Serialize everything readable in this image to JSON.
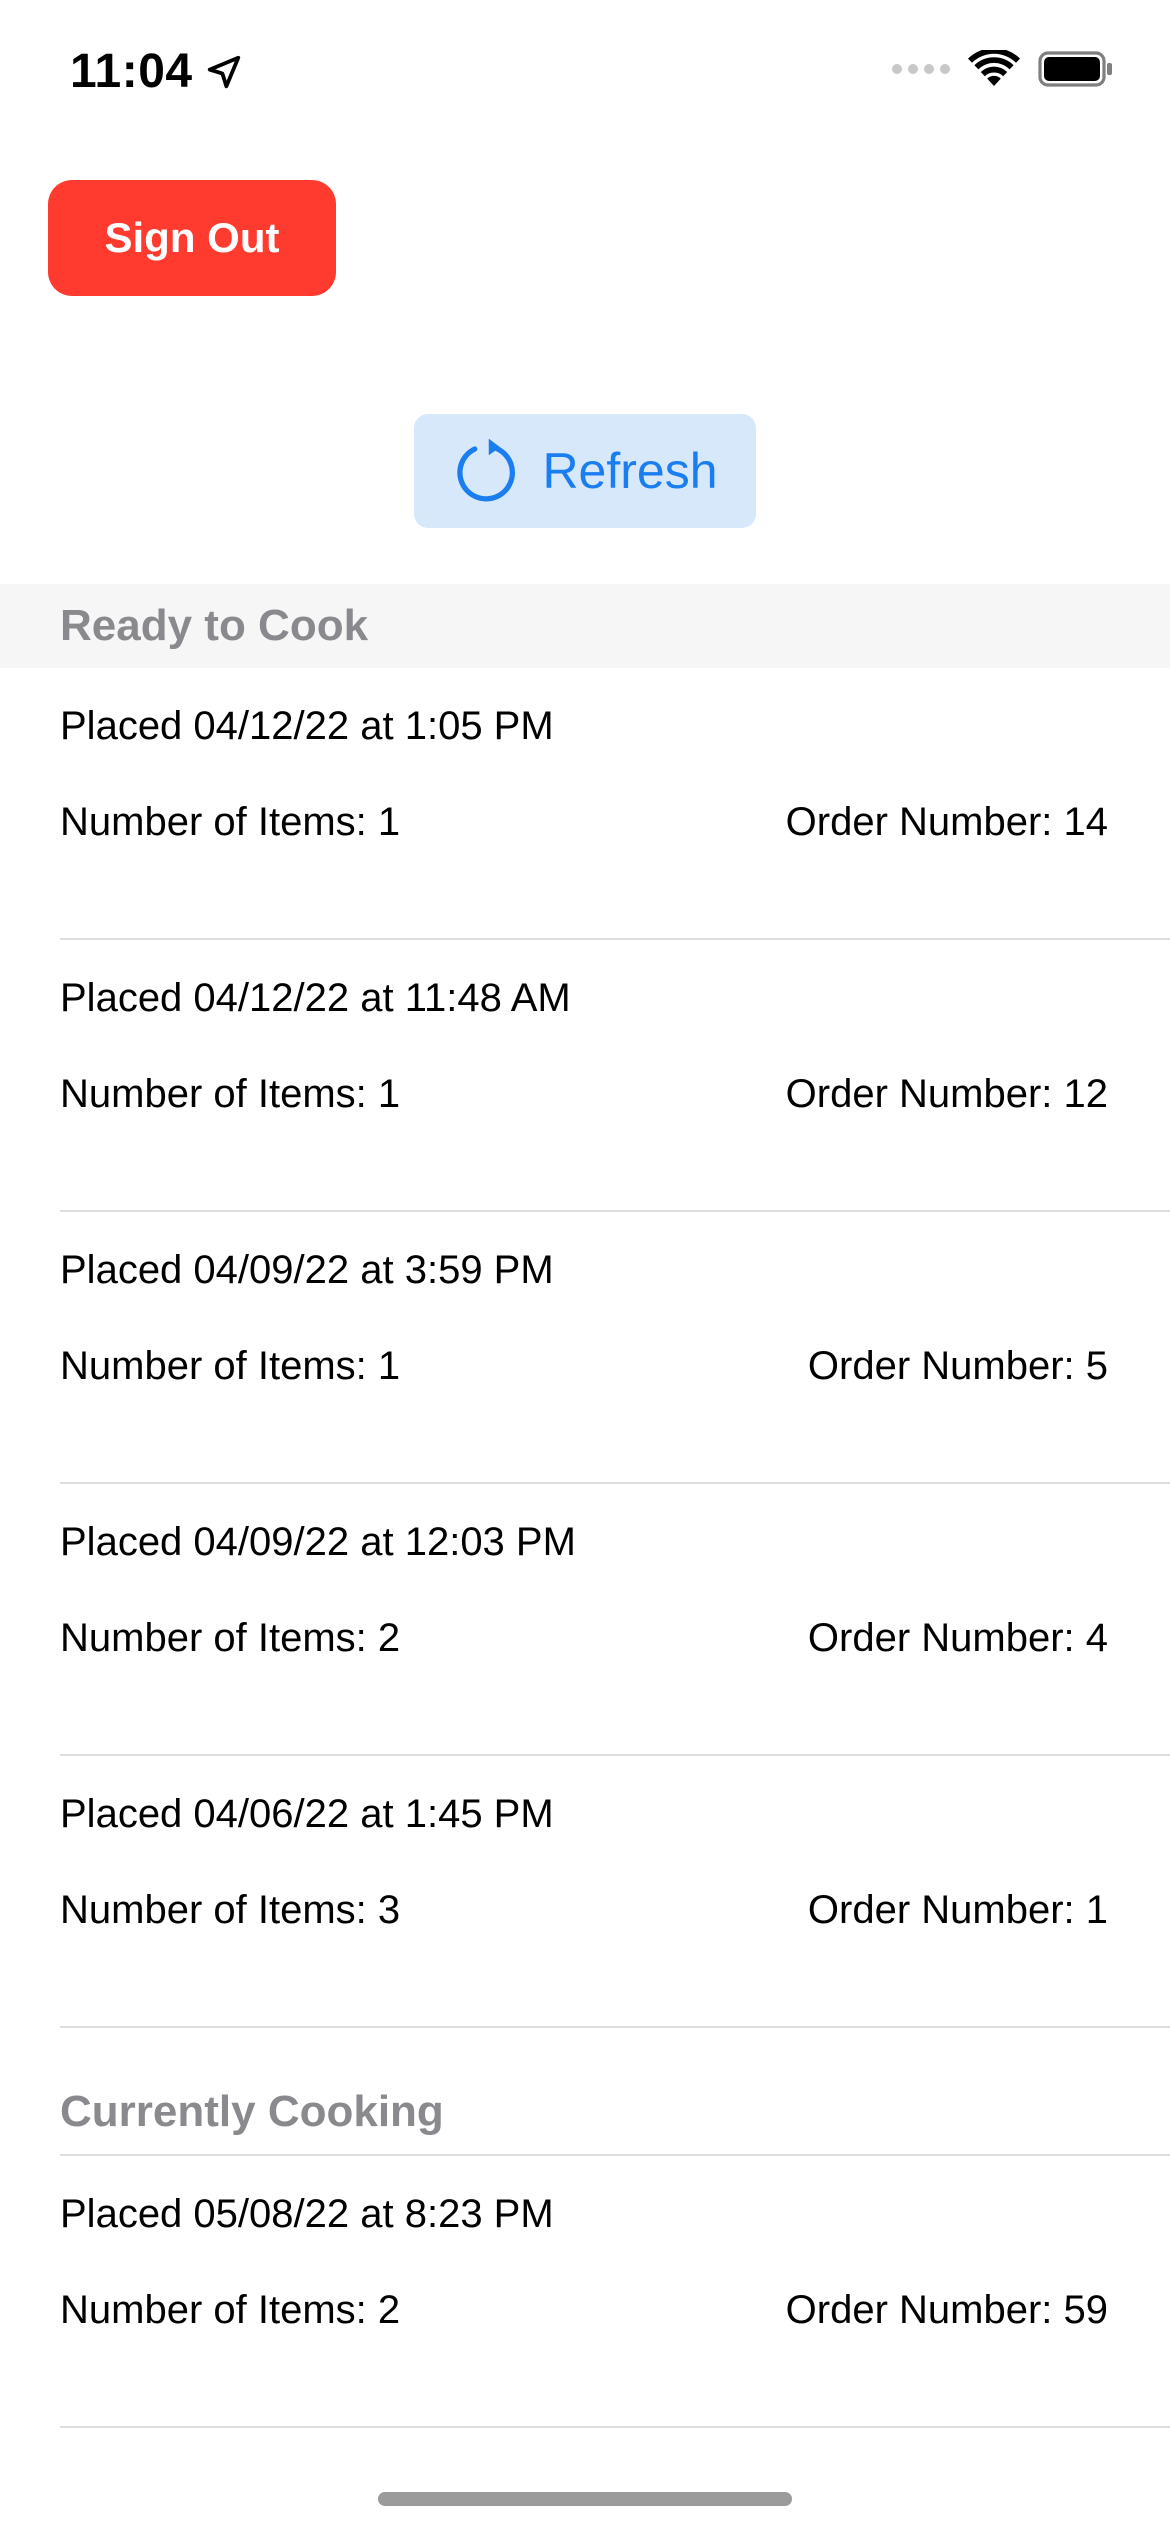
{
  "status_bar": {
    "time": "11:04",
    "icons": [
      "location-arrow-icon",
      "cellular-signal-icon",
      "wifi-icon",
      "battery-icon"
    ]
  },
  "sign_out_label": "Sign Out",
  "refresh": {
    "label": "Refresh",
    "icon": "refresh-icon"
  },
  "colors": {
    "sign_out_bg": "#ff3b30",
    "refresh_bg": "#d7e8fb",
    "accent_blue": "#1a7df0",
    "section_header_text": "#8a8a8e"
  },
  "sections": [
    {
      "title": "Ready to Cook",
      "orders": [
        {
          "placed": "Placed 04/12/22 at 1:05 PM",
          "items": "Number of Items: 1",
          "number": "Order Number: 14"
        },
        {
          "placed": "Placed 04/12/22 at 11:48 AM",
          "items": "Number of Items: 1",
          "number": "Order Number: 12"
        },
        {
          "placed": "Placed 04/09/22 at 3:59 PM",
          "items": "Number of Items: 1",
          "number": "Order Number: 5"
        },
        {
          "placed": "Placed 04/09/22 at 12:03 PM",
          "items": "Number of Items: 2",
          "number": "Order Number: 4"
        },
        {
          "placed": "Placed 04/06/22 at 1:45 PM",
          "items": "Number of Items: 3",
          "number": "Order Number: 1"
        }
      ]
    },
    {
      "title": "Currently Cooking",
      "orders": [
        {
          "placed": "Placed 05/08/22 at 8:23 PM",
          "items": "Number of Items: 2",
          "number": "Order Number: 59"
        }
      ]
    }
  ]
}
